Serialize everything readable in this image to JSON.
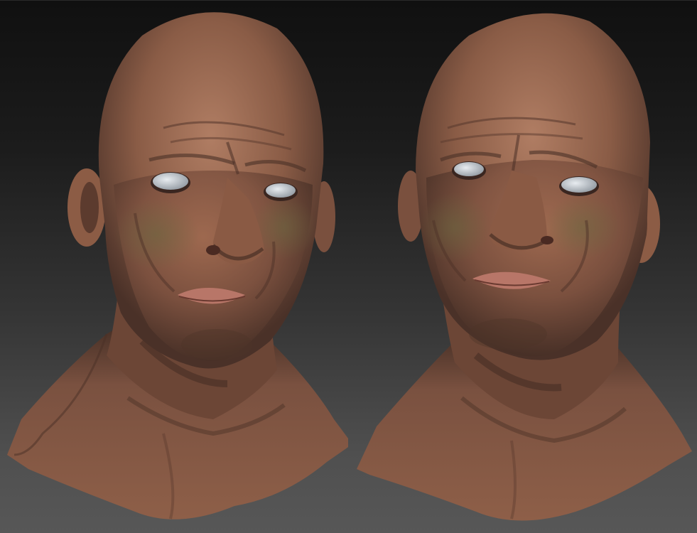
{
  "viewport": {
    "background_top": "#101010",
    "background_bottom": "#575757"
  },
  "sculpts": [
    {
      "view": "three-quarter-left",
      "skin_color": "#8a5a44"
    },
    {
      "view": "three-quarter-right",
      "skin_color": "#8a5a44"
    }
  ]
}
